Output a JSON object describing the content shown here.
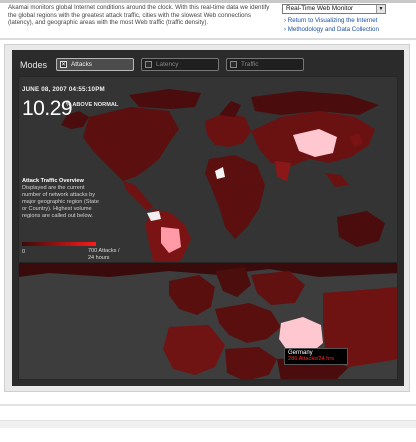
{
  "intro": {
    "lines": [
      "Akamai monitors global Internet conditions around the clock. With this real-time data we identify",
      "the global regions with the greatest attack traffic, cities with the slowest Web connections",
      "(latency), and geographic areas with the most Web traffic (traffic density)."
    ]
  },
  "monitor_select": {
    "value": "Real-Time Web Monitor",
    "arrow_icon": "chevron-down-icon"
  },
  "links": [
    "› Return to Visualizing the Internet",
    "› Methodology and Data Collection"
  ],
  "viz": {
    "modes_title": "Modes",
    "tabs": [
      {
        "label": "Attacks",
        "active": true
      },
      {
        "label": "Latency",
        "active": false
      },
      {
        "label": "Traffic",
        "active": false
      }
    ],
    "timestamp": "JUNE 08, 2007 04:55:10PM",
    "big_value": "10.29",
    "big_unit": "% ABOVE NORMAL",
    "overview": {
      "heading": "Attack Traffic Overview",
      "lines": [
        "Displayed are the current",
        "number of network attacks by",
        "major geographic region (State",
        "or Country). Highest volume",
        "regions are called out below."
      ]
    },
    "legend": {
      "min": "0",
      "max_line1": "700 Attacks /",
      "max_line2": "24 hours"
    },
    "tooltip": {
      "country": "Germany",
      "metric": "286 Attacks/24 hrs"
    },
    "colors": {
      "background": "#2b2b2b",
      "land_low": "#4a0c0c",
      "land_mid": "#7a1414",
      "land_high": "#ff9aa6",
      "highlight": "#ffc8d0",
      "tooltip_metric": "#ff2a2a"
    }
  }
}
